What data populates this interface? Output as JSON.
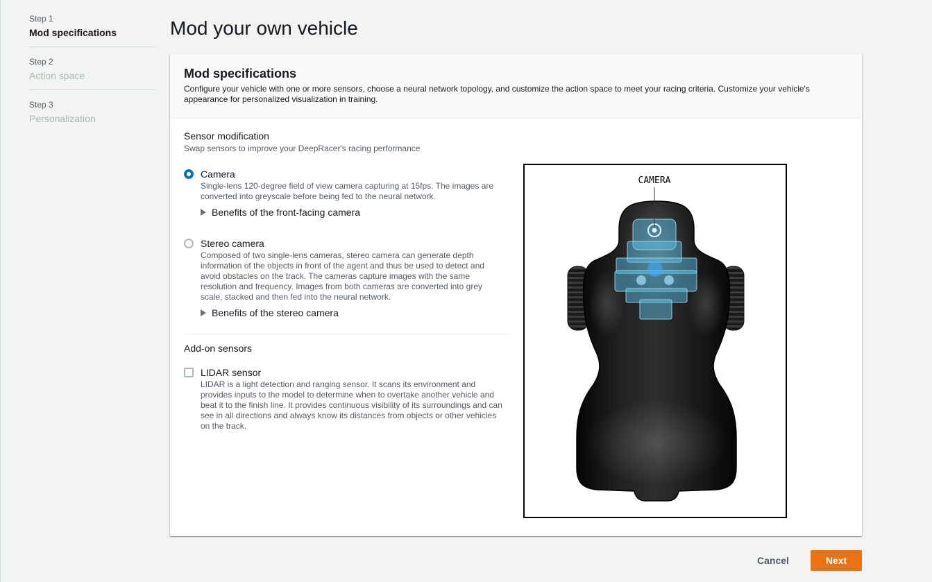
{
  "wizard": {
    "steps": [
      {
        "step": "Step 1",
        "label": "Mod specifications",
        "current": true,
        "enabled": true
      },
      {
        "step": "Step 2",
        "label": "Action space",
        "current": false,
        "enabled": false
      },
      {
        "step": "Step 3",
        "label": "Personalization",
        "current": false,
        "enabled": false
      }
    ]
  },
  "page": {
    "title": "Mod your own vehicle"
  },
  "card": {
    "title": "Mod specifications",
    "description": "Configure your vehicle with one or more sensors, choose a neural network topology, and customize the action space to meet your racing criteria. Customize your vehicle's appearance for personalized visualization in training."
  },
  "sensor_modification": {
    "heading": "Sensor modification",
    "subheading": "Swap sensors to improve your DeepRacer's racing performance",
    "options": [
      {
        "label": "Camera",
        "selected": true,
        "description": "Single-lens 120-degree field of view camera capturing at 15fps. The images are converted into greyscale before being fed to the neural network.",
        "expander": "Benefits of the front-facing camera"
      },
      {
        "label": "Stereo camera",
        "selected": false,
        "description": "Composed of two single-lens cameras, stereo camera can generate depth information of the objects in front of the agent and thus be used to detect and avoid obstacles on the track. The cameras capture images with the same resolution and frequency. Images from both cameras are converted into grey scale, stacked and then fed into the neural network.",
        "expander": "Benefits of the stereo camera"
      }
    ]
  },
  "addon_sensors": {
    "heading": "Add-on sensors",
    "options": [
      {
        "label": "LIDAR sensor",
        "checked": false,
        "description": "LIDAR is a light detection and ranging sensor. It scans its environment and provides inputs to the model to determine when to overtake another vehicle and beat it to the finish line. It provides continuous visibility of its surroundings and can see in all directions and always know its distances from objects or other vehicles on the track."
      }
    ]
  },
  "vehicle_preview": {
    "callout_label": "CAMERA"
  },
  "footer": {
    "cancel_label": "Cancel",
    "next_label": "Next"
  },
  "icons": {
    "expander": "caret-right-icon"
  },
  "colors": {
    "accent": "#ec7211",
    "radio": "#0073bb",
    "background": "#f2f3f3",
    "camera_module": "#5ec8f2"
  }
}
